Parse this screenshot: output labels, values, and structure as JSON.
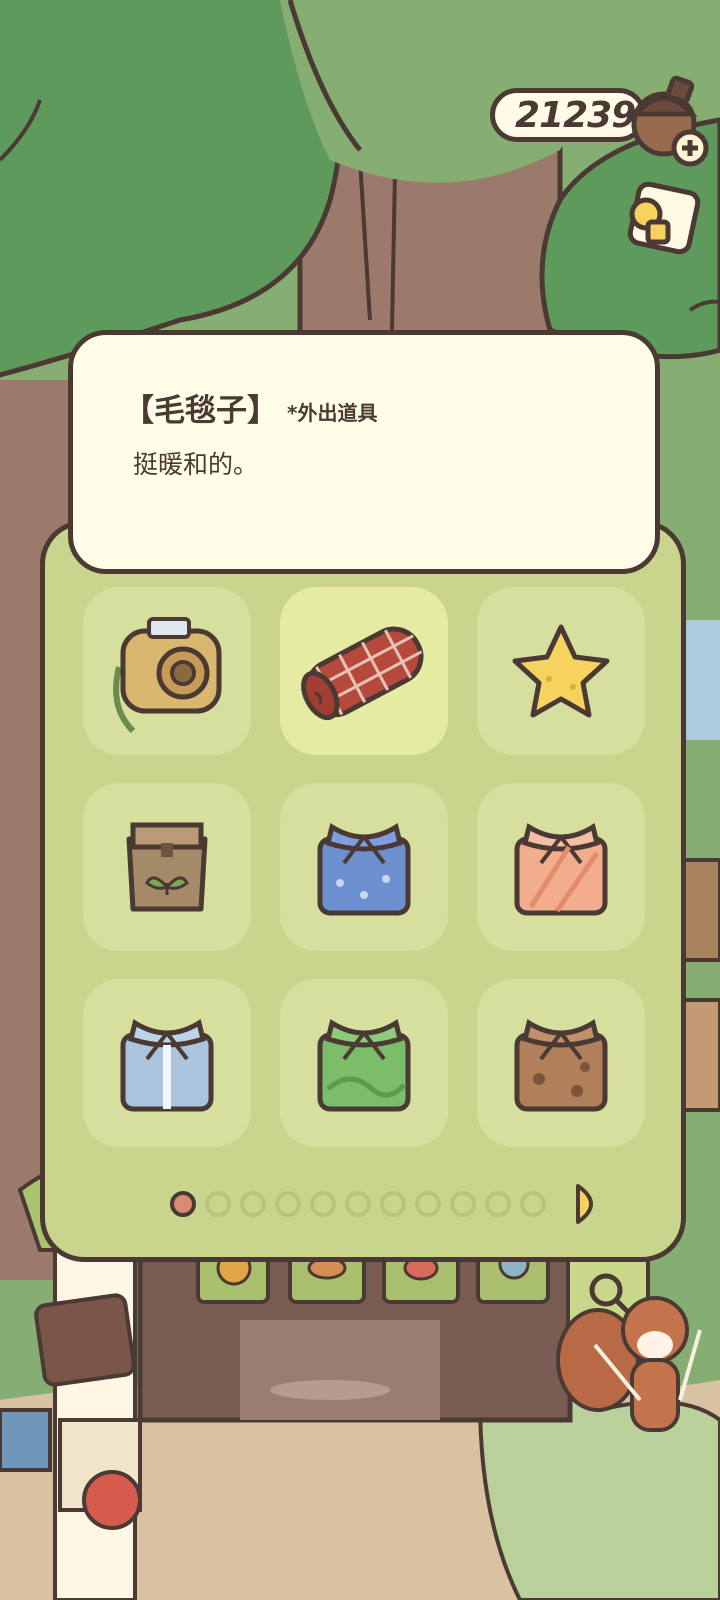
{
  "hud": {
    "currency_value": "21239",
    "currency_icon": "acorn-plus-icon",
    "camera_icon": "goggles-icon"
  },
  "item_detail": {
    "name": "【毛毯子】",
    "tag": "*外出道具",
    "description": "挺暖和的。"
  },
  "inventory": {
    "items": [
      {
        "icon": "camera-bag-icon",
        "selected": false
      },
      {
        "icon": "blanket-icon",
        "selected": true
      },
      {
        "icon": "star-icon",
        "selected": false
      },
      {
        "icon": "lunch-bag-icon",
        "selected": false
      },
      {
        "icon": "gift-blue-icon",
        "selected": false
      },
      {
        "icon": "gift-peach-icon",
        "selected": false
      },
      {
        "icon": "gift-lightblue-icon",
        "selected": false
      },
      {
        "icon": "gift-green-icon",
        "selected": false
      },
      {
        "icon": "gift-brown-icon",
        "selected": false
      }
    ],
    "pages_total": 11,
    "current_page": 1
  },
  "shop_banners": [
    "yarn-icon",
    "leaf-icon",
    "candy-icon",
    "snail-icon",
    "magnifier-icon"
  ],
  "colors": {
    "outline": "#4a3a33",
    "panel": "#c9d48c",
    "card": "#fffce7",
    "sky_green": "#86ad72",
    "active_dot": "#d98a74"
  }
}
